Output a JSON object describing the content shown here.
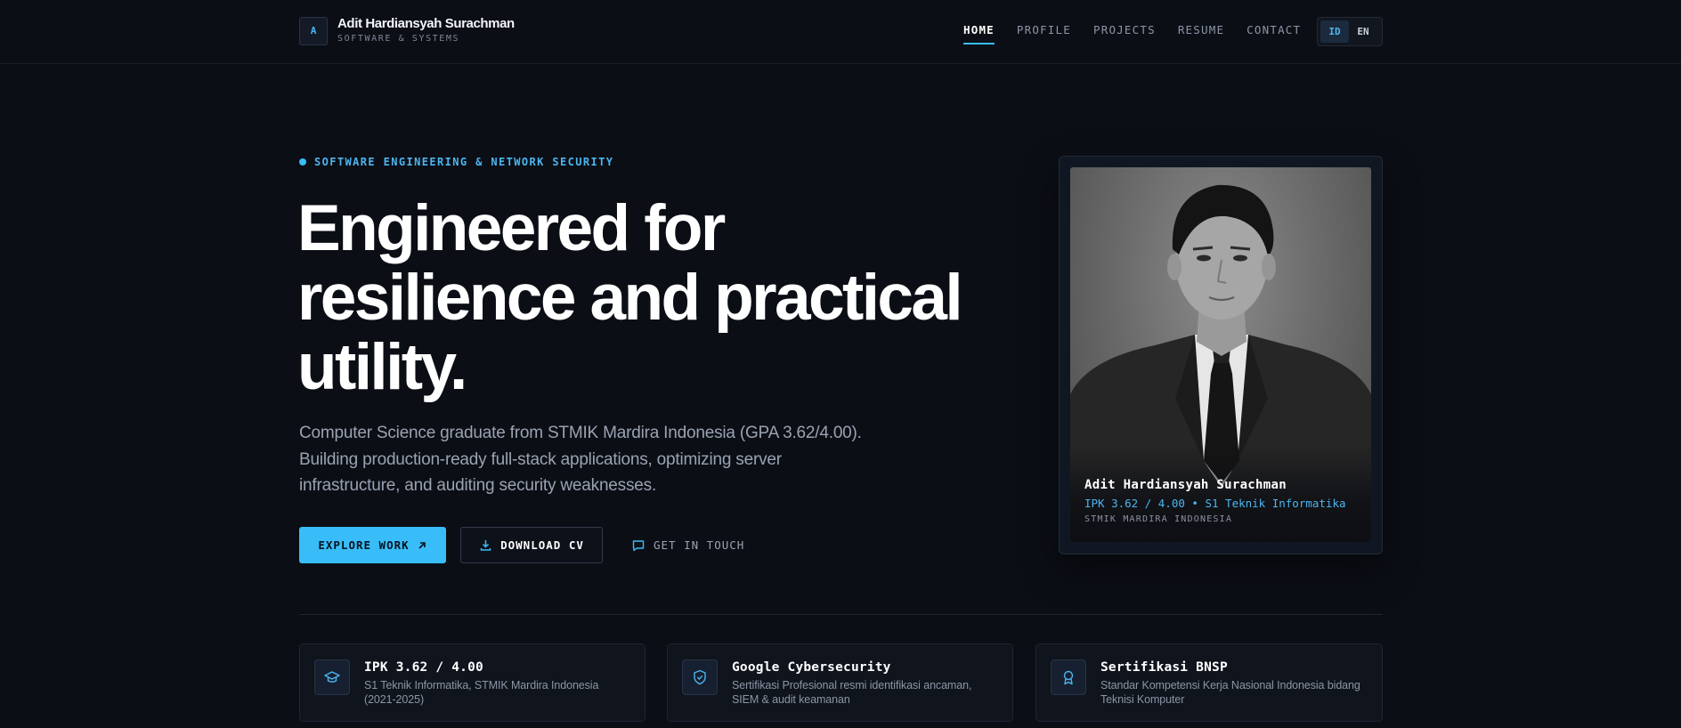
{
  "header": {
    "logo_letter": "A",
    "brand_name": "Adit Hardiansyah Surachman",
    "brand_sub": "SOFTWARE & SYSTEMS",
    "nav": [
      {
        "label": "HOME",
        "active": true
      },
      {
        "label": "PROFILE",
        "active": false
      },
      {
        "label": "PROJECTS",
        "active": false
      },
      {
        "label": "RESUME",
        "active": false
      },
      {
        "label": "CONTACT",
        "active": false
      }
    ],
    "lang": [
      {
        "label": "ID",
        "active": true
      },
      {
        "label": "EN",
        "active": false
      }
    ]
  },
  "hero": {
    "eyebrow": "SOFTWARE ENGINEERING & NETWORK SECURITY",
    "headline": "Engineered for resilience and practical utility.",
    "lead": "Computer Science graduate from STMIK Mardira Indonesia (GPA 3.62/4.00). Building production-ready full-stack applications, optimizing server infrastructure, and auditing security weaknesses.",
    "cta_primary": "EXPLORE WORK",
    "cta_secondary": "DOWNLOAD CV",
    "cta_ghost": "GET IN TOUCH"
  },
  "portrait": {
    "name": "Adit Hardiansyah Surachman",
    "meta": "IPK 3.62 / 4.00 • S1 Teknik Informatika",
    "school": "STMIK MARDIRA INDONESIA"
  },
  "features": [
    {
      "icon": "graduation-cap-icon",
      "title": "IPK 3.62 / 4.00",
      "desc": "S1 Teknik Informatika, STMIK Mardira Indonesia (2021-2025)"
    },
    {
      "icon": "shield-icon",
      "title": "Google Cybersecurity",
      "desc": "Sertifikasi Profesional resmi identifikasi ancaman, SIEM & audit keamanan"
    },
    {
      "icon": "award-icon",
      "title": "Sertifikasi BNSP",
      "desc": "Standar Kompetensi Kerja Nasional Indonesia bidang Teknisi Komputer"
    }
  ],
  "colors": {
    "background": "#0b0e15",
    "accent": "#38bdf8",
    "text": "#ffffff",
    "muted": "#9aa3b2"
  }
}
